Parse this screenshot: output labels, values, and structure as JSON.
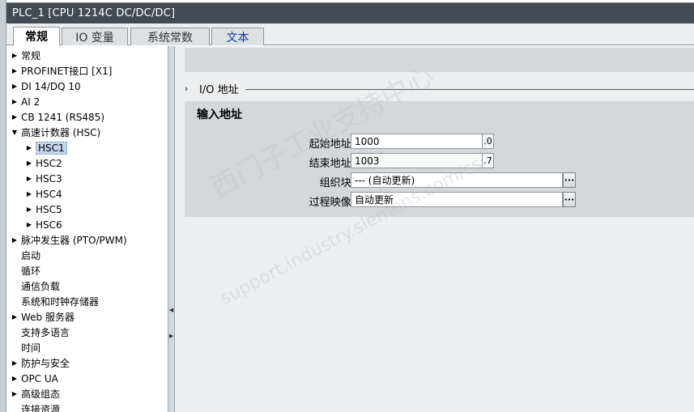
{
  "window": {
    "title": "PLC_1 [CPU 1214C DC/DC/DC]"
  },
  "tabs": [
    {
      "label": "常规"
    },
    {
      "label": "IO 变量"
    },
    {
      "label": "系统常数"
    },
    {
      "label": "文本"
    }
  ],
  "sidebar": {
    "items": [
      {
        "label": "常规",
        "arrow": "right"
      },
      {
        "label": "PROFINET接口 [X1]",
        "arrow": "right"
      },
      {
        "label": "DI 14/DQ 10",
        "arrow": "right"
      },
      {
        "label": "AI 2",
        "arrow": "right"
      },
      {
        "label": "CB 1241 (RS485)",
        "arrow": "right"
      },
      {
        "label": "高速计数器 (HSC)",
        "arrow": "down"
      },
      {
        "label": "HSC1",
        "arrow": "right"
      },
      {
        "label": "HSC2",
        "arrow": "right"
      },
      {
        "label": "HSC3",
        "arrow": "right"
      },
      {
        "label": "HSC4",
        "arrow": "right"
      },
      {
        "label": "HSC5",
        "arrow": "right"
      },
      {
        "label": "HSC6",
        "arrow": "right"
      },
      {
        "label": "脉冲发生器 (PTO/PWM)",
        "arrow": "right"
      },
      {
        "label": "启动",
        "arrow": "none"
      },
      {
        "label": "循环",
        "arrow": "none"
      },
      {
        "label": "通信负载",
        "arrow": "none"
      },
      {
        "label": "系统和时钟存储器",
        "arrow": "none"
      },
      {
        "label": "Web 服务器",
        "arrow": "right"
      },
      {
        "label": "支持多语言",
        "arrow": "none"
      },
      {
        "label": "时间",
        "arrow": "none"
      },
      {
        "label": "防护与安全",
        "arrow": "right"
      },
      {
        "label": "OPC UA",
        "arrow": "right"
      },
      {
        "label": "高级组态",
        "arrow": "right"
      },
      {
        "label": "连接资源",
        "arrow": "none"
      }
    ]
  },
  "main": {
    "section_title": "I/O 地址",
    "panel_title": "输入地址",
    "start_address": {
      "label": "起始地址:",
      "value": "1000",
      "suffix": ".0"
    },
    "end_address": {
      "label": "结束地址:",
      "value": "1003",
      "suffix": ".7"
    },
    "organization_block": {
      "label": "组织块:",
      "value": "--- (自动更新)"
    },
    "process_image": {
      "label": "过程映像:",
      "value": "自动更新"
    }
  },
  "watermark": {
    "line1": "西门子工业支持中心",
    "line2": "support.industry.siemens.com/cs"
  }
}
